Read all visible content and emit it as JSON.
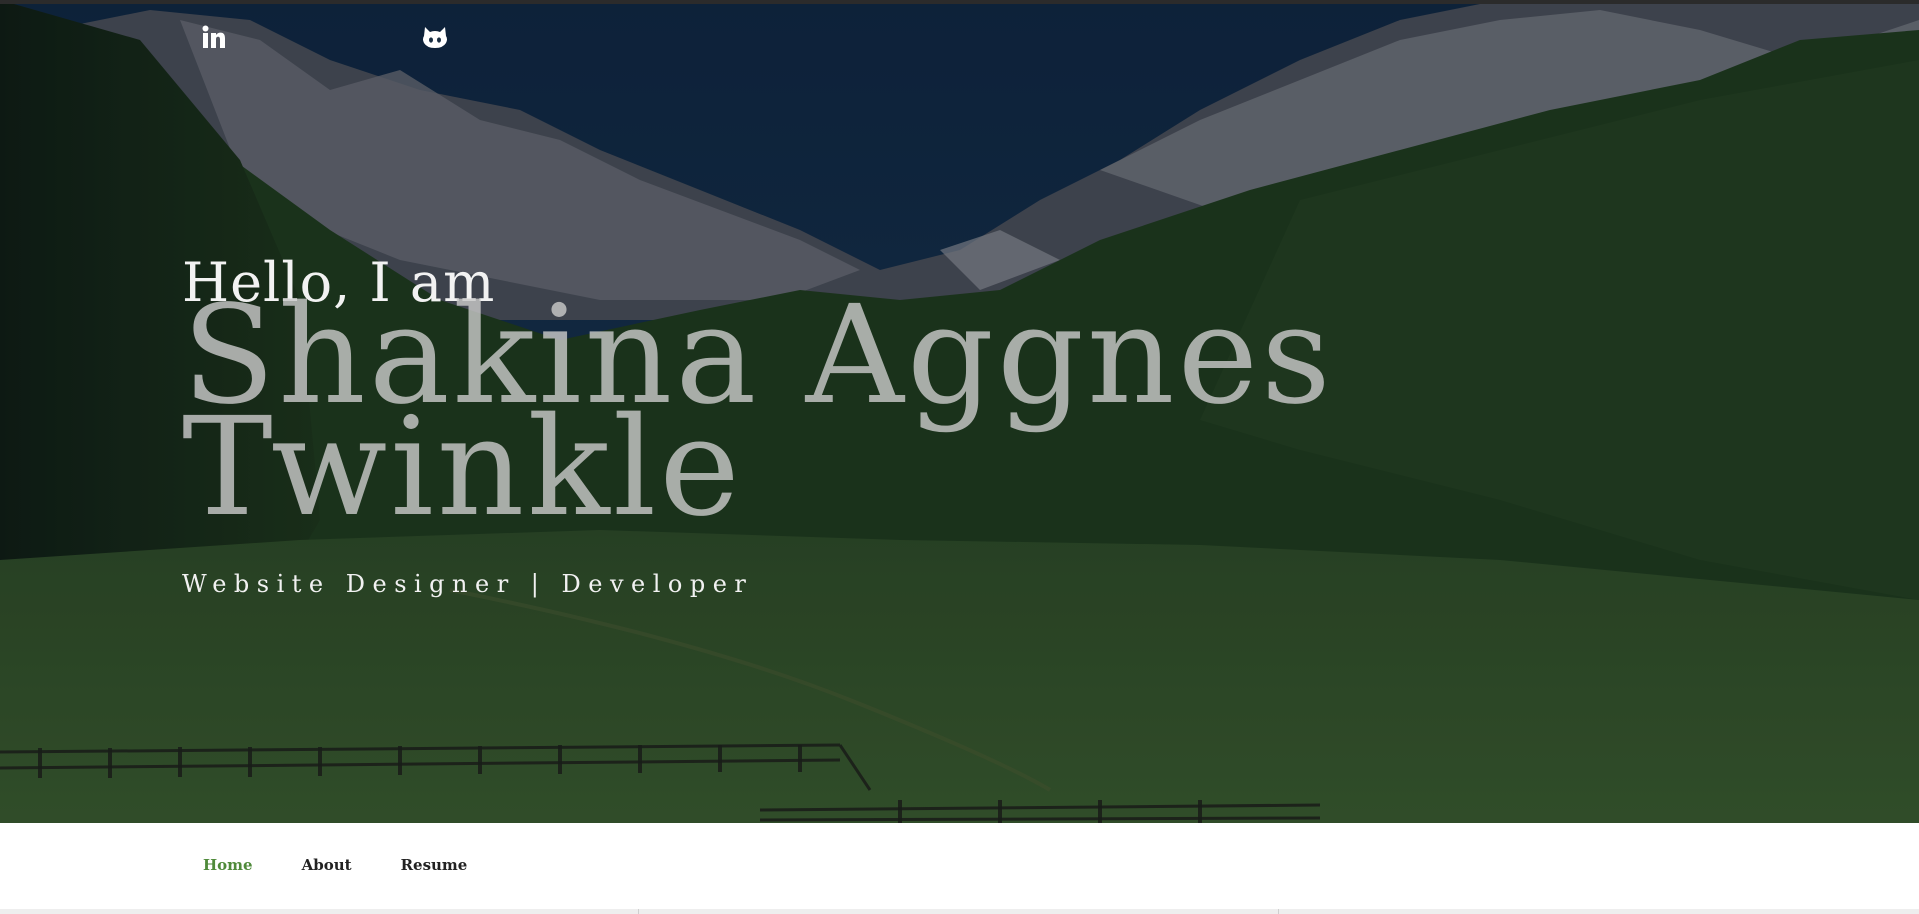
{
  "social": {
    "linkedin_icon": "linkedin-icon",
    "github_icon": "github-icon"
  },
  "hero": {
    "greeting": "Hello, I am",
    "name_line1": "Shakina Aggnes",
    "name_line2": "Twinkle",
    "tagline": "Website Designer | Developer"
  },
  "nav": {
    "items": [
      {
        "label": "Home",
        "active": true
      },
      {
        "label": "About",
        "active": false
      },
      {
        "label": "Resume",
        "active": false
      }
    ]
  },
  "colors": {
    "accent": "#4f8a3a",
    "overlay": "#0d2a45"
  }
}
